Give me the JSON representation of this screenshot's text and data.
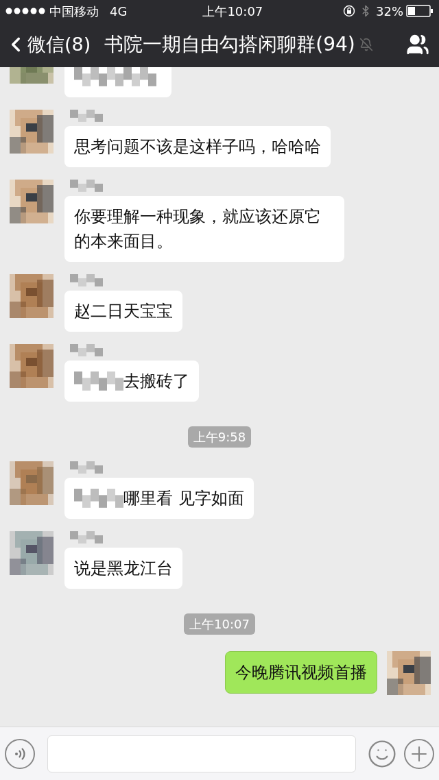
{
  "status_bar": {
    "carrier": "中国移动",
    "network": "4G",
    "time": "上午10:07",
    "battery": "32%"
  },
  "nav": {
    "back": "微信(8)",
    "title": "书院一期自由勾搭闲聊群(94)"
  },
  "messages": [
    {
      "kind": "redacted"
    },
    {
      "kind": "received",
      "text": "思考问题不该是这样子吗，哈哈哈",
      "redacted_prefix": false
    },
    {
      "kind": "received",
      "text": "你要理解一种现象，就应该还原它的本来面目。",
      "redacted_prefix": false
    },
    {
      "kind": "received",
      "text": "赵二日天宝宝",
      "redacted_prefix": false
    },
    {
      "kind": "received",
      "text": "去搬砖了",
      "redacted_prefix": true
    },
    {
      "kind": "time",
      "text": "上午9:58"
    },
    {
      "kind": "received",
      "text": "哪里看 见字如面",
      "redacted_prefix": true
    },
    {
      "kind": "received",
      "text": "说是黑龙江台",
      "redacted_prefix": false
    },
    {
      "kind": "time",
      "text": "上午10:07"
    },
    {
      "kind": "sent",
      "text": "今晚腾讯视频首播"
    }
  ]
}
